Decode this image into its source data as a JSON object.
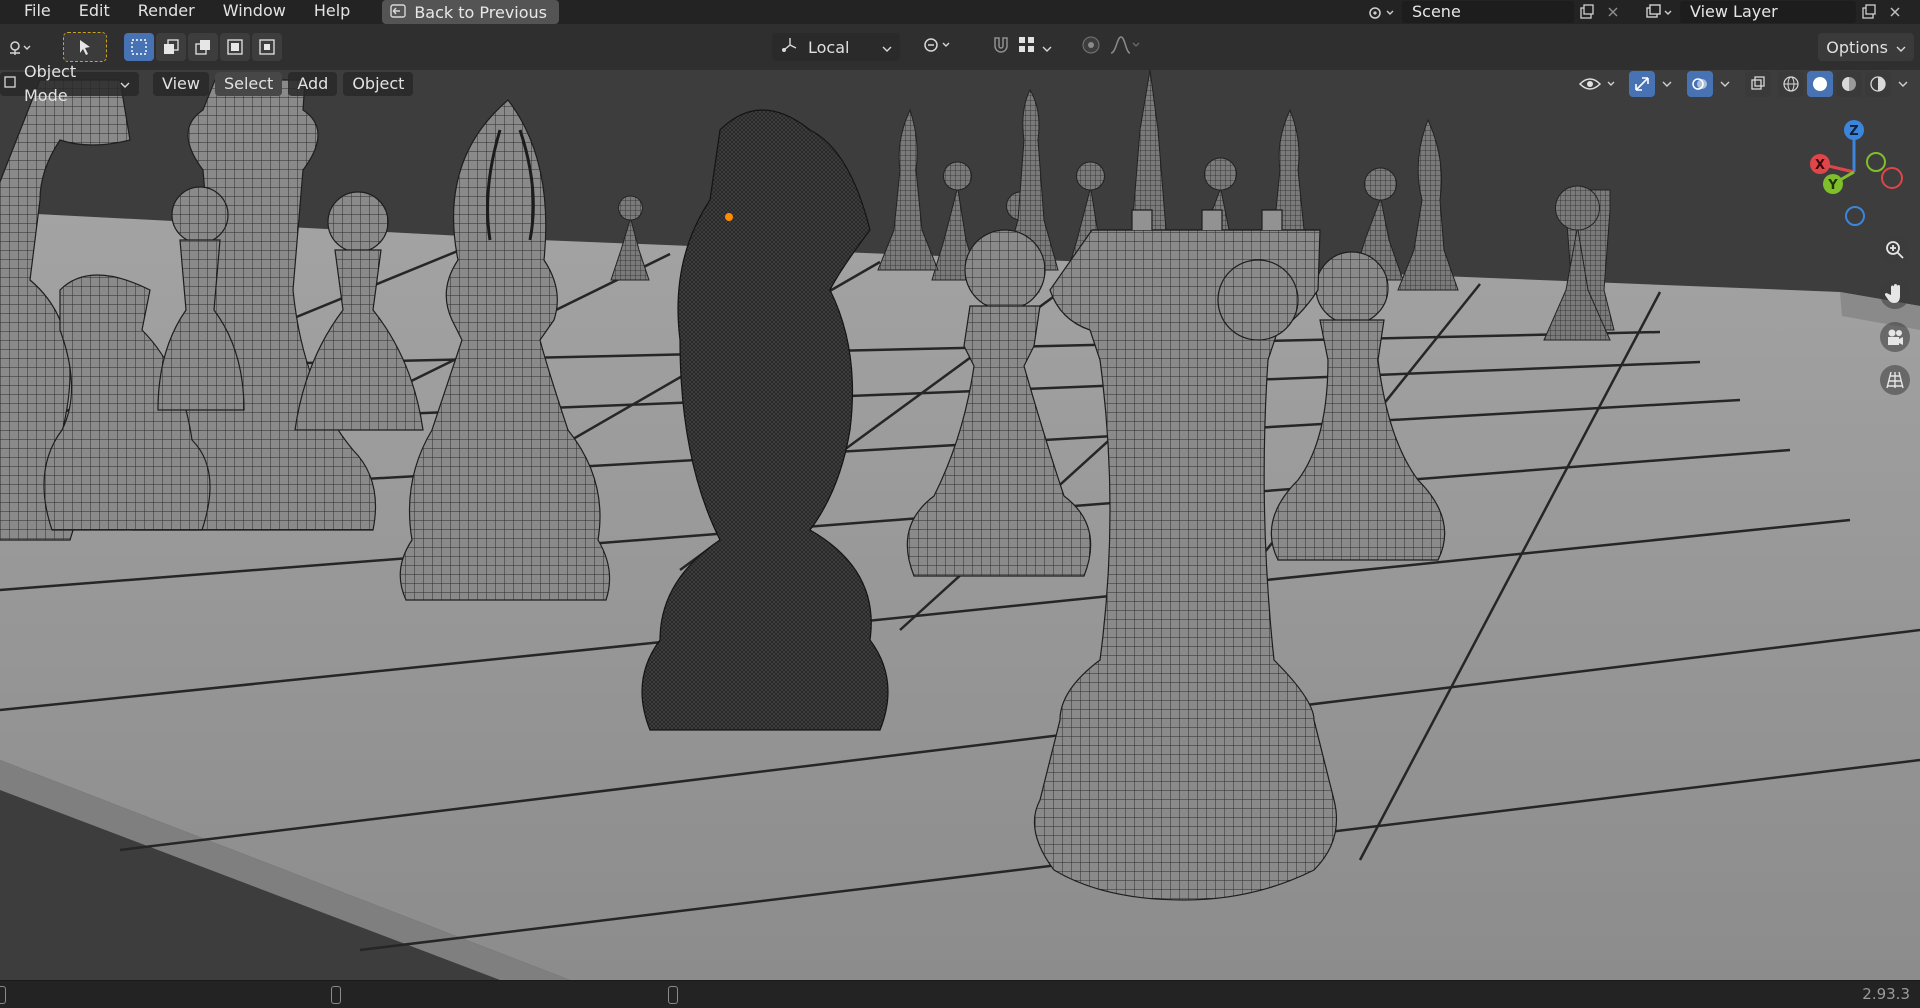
{
  "menu": {
    "items": [
      "File",
      "Edit",
      "Render",
      "Window",
      "Help"
    ],
    "back_label": "Back to Previous"
  },
  "scene": {
    "label": "Scene"
  },
  "view_layer": {
    "label": "View Layer"
  },
  "header": {
    "transform_orientation": "Local",
    "options_label": "Options"
  },
  "viewport_menu": {
    "mode": "Object Mode",
    "items": [
      "View",
      "Select",
      "Add",
      "Object"
    ],
    "selected_item": "Select"
  },
  "gizmo": {
    "z": "Z",
    "y": "Y",
    "x": "X"
  },
  "status": {
    "version": "2.93.3"
  },
  "colors": {
    "accent": "#4772b3",
    "axis_x": "#e0454a",
    "axis_y": "#7fbf2b",
    "axis_z": "#3b86dc",
    "selection_origin": "#ff8c00"
  }
}
